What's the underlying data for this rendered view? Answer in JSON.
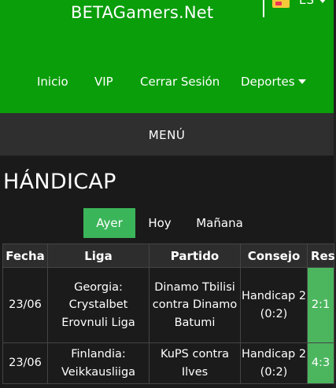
{
  "header": {
    "brand": "BETAGamers.Net",
    "language": "ES",
    "nav": [
      {
        "label": "Inicio"
      },
      {
        "label": "VIP"
      },
      {
        "label": "Cerrar Sesión"
      },
      {
        "label": "Deportes"
      }
    ]
  },
  "menu": {
    "label": "MENÚ"
  },
  "page": {
    "title": "HÁNDICAP"
  },
  "tabs": [
    {
      "label": "Ayer",
      "active": true
    },
    {
      "label": "Hoy",
      "active": false
    },
    {
      "label": "Mañana",
      "active": false
    }
  ],
  "table": {
    "headers": [
      "Fecha",
      "Liga",
      "Partido",
      "Consejo",
      "Res"
    ],
    "rows": [
      {
        "fecha": "23/06",
        "liga": "Georgia: Crystalbet Erovnuli Liga",
        "partido": "Dinamo Tbilisi contra Dinamo Batumi",
        "consejo": "Handicap 2 (0:2)",
        "res": "2:1"
      },
      {
        "fecha": "23/06",
        "liga": "Finlandia: Veikkausliiga",
        "partido": "KuPS contra Ilves",
        "consejo": "Handicap 2 (0:2)",
        "res": "4:3"
      }
    ]
  },
  "colors": {
    "header_green": "#0a9e0a",
    "active_tab": "#3bb55a",
    "result_green": "#4cb65f"
  }
}
